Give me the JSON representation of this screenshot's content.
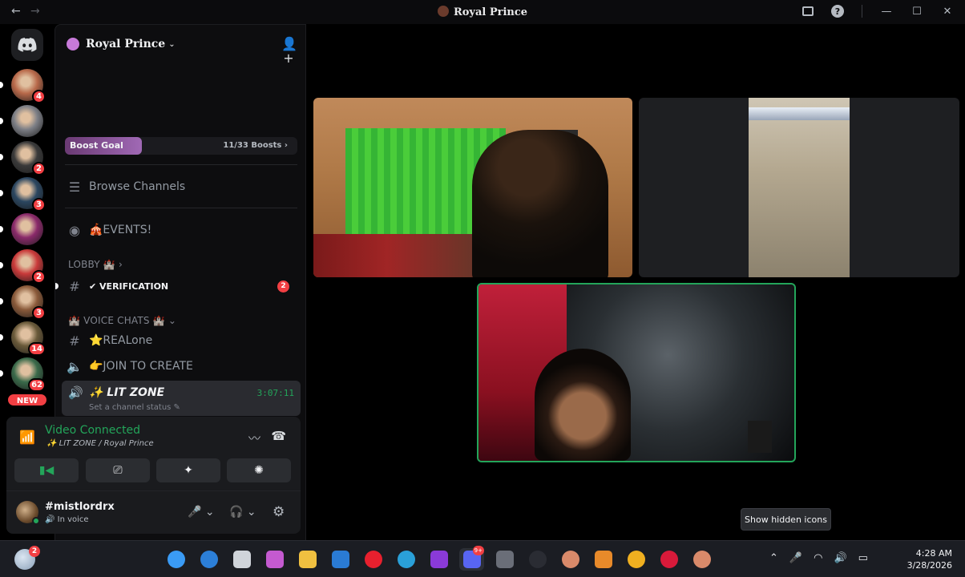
{
  "window": {
    "title": "Royal Prince",
    "back_icon": "←",
    "forward_icon": "→",
    "minimize_icon": "—",
    "maximize_icon": "☐",
    "close_icon": "✕",
    "help_label": "?"
  },
  "rail": {
    "servers": [
      {
        "badge": "4",
        "color": "#b8694a"
      },
      {
        "badge": "",
        "color": "#7d7f86"
      },
      {
        "badge": "2",
        "color": "#3a3a3a"
      },
      {
        "badge": "3",
        "color": "#2b4660"
      },
      {
        "badge": "",
        "color": "#8a2a6a"
      },
      {
        "badge": "2",
        "color": "#c93a3a"
      },
      {
        "badge": "3",
        "color": "#8a5a3a"
      },
      {
        "badge": "14",
        "color": "#6a5a3a"
      },
      {
        "badge": "62",
        "color": "#3a6a4a"
      }
    ],
    "new_label": "NEW"
  },
  "server": {
    "name": "Royal Prince",
    "chevron": "⌄",
    "invite_icon": "👤+"
  },
  "boost": {
    "label": "Boost Goal",
    "count": "11/33 Boosts ›",
    "progress": 0.33
  },
  "channels": {
    "browse": "Browse Channels",
    "events": "🎪EVENTS!",
    "lobby_category": "LOBBY 🏰 ›",
    "verification": "✔ VERIFICATION",
    "verification_badge": "2",
    "voice_category": "🏰 VOICE CHATS 🏰 ⌄",
    "realone": "⭐REALone",
    "join_to_create": "👉JOIN TO CREATE",
    "active": {
      "name": "✨ LIT ZONE",
      "status": "Set a channel status ✎",
      "timer": "3:07:11"
    }
  },
  "voice": {
    "title": "Video Connected",
    "subtitle": "✨ LIT ZONE / Royal Prince",
    "buttons": {
      "camera": "▮◀",
      "screen": "⎚",
      "activities": "✦",
      "soundboard": "✺"
    }
  },
  "user": {
    "name": "#mistlordrx",
    "status": "🔊 In voice",
    "mic": "🎤 ⌄",
    "headset": "🎧 ⌄",
    "settings": "⚙"
  },
  "tooltip": "Show hidden icons",
  "taskbar": {
    "weather_badge": "2",
    "apps": [
      {
        "name": "start",
        "color": "#3a9bf5",
        "badge": ""
      },
      {
        "name": "search",
        "color": "#2c7fd8",
        "badge": ""
      },
      {
        "name": "task-view",
        "color": "#d0d4da",
        "badge": ""
      },
      {
        "name": "copilot",
        "color": "#c45ad0",
        "badge": ""
      },
      {
        "name": "file-explorer",
        "color": "#f0c040",
        "badge": ""
      },
      {
        "name": "outlook",
        "color": "#2a7bd4",
        "badge": ""
      },
      {
        "name": "opera",
        "color": "#e8202e",
        "badge": ""
      },
      {
        "name": "edge",
        "color": "#2aa0d8",
        "badge": ""
      },
      {
        "name": "clipchamp",
        "color": "#8a3ad8",
        "badge": ""
      },
      {
        "name": "discord",
        "color": "#5865f2",
        "badge": "9+"
      },
      {
        "name": "camera",
        "color": "#6a6e78",
        "badge": ""
      },
      {
        "name": "obs",
        "color": "#2a2c33",
        "badge": ""
      },
      {
        "name": "app-face-1",
        "color": "#d98a6a",
        "badge": ""
      },
      {
        "name": "fl-studio",
        "color": "#e88a2a",
        "badge": ""
      },
      {
        "name": "chrome",
        "color": "#f0b020",
        "badge": ""
      },
      {
        "name": "opera-gx",
        "color": "#d81a3a",
        "badge": ""
      },
      {
        "name": "app-face-2",
        "color": "#d98a6a",
        "badge": ""
      }
    ],
    "tray": {
      "chevron": "⌃",
      "mic": "🎤",
      "wifi": "◠",
      "volume": "🔊",
      "battery": "▭"
    },
    "time": "4:28 AM",
    "date": "3/28/2026"
  }
}
